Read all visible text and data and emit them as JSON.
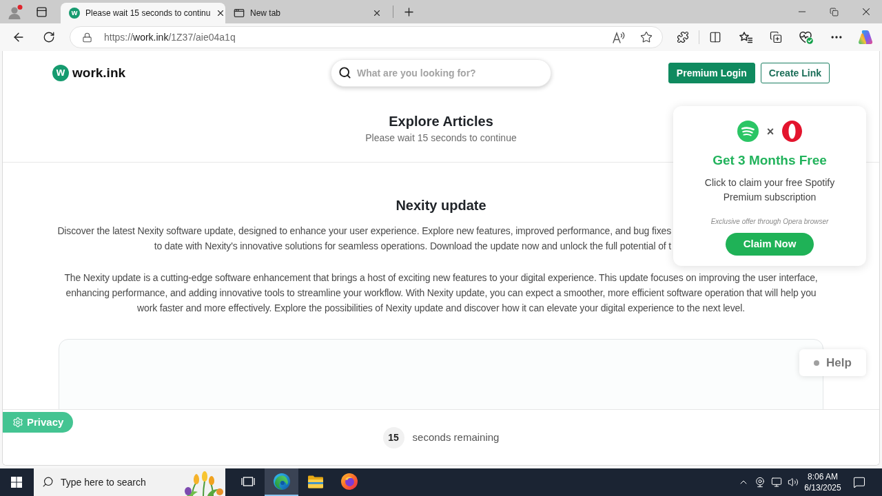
{
  "browser": {
    "tabs": [
      {
        "title": "Please wait 15 seconds to continu",
        "favicon": "w",
        "selected": true
      },
      {
        "title": "New tab",
        "selected": false
      }
    ],
    "address": {
      "scheme": "https://",
      "host": "work.ink",
      "path": "/1Z37/aie04a1q"
    }
  },
  "header": {
    "logo": {
      "mark": "w",
      "name": "work.ink"
    },
    "search": {
      "placeholder": "What are you looking for?"
    },
    "buttons": [
      {
        "label": "Premium Login",
        "kind": "filled"
      },
      {
        "label": "Create Link",
        "kind": "outline"
      }
    ]
  },
  "hero": {
    "title": "Explore Articles",
    "subtitle": "Please wait 15 seconds to continue"
  },
  "article": {
    "title": "Nexity update",
    "paragraphs": [
      {
        "kind": "partly_hidden",
        "lines": [
          "Discover the latest Nexity software update, designed to enhance your user experience. Explore new features, improved performance, and bug fixes",
          "to date with Nexity's innovative solutions for seamless operations. Download the update now and unlock the full potential of t"
        ]
      },
      {
        "kind": "full",
        "lines": [
          "The Nexity update is a cutting-edge software enhancement that brings a host of exciting new features to your digital experience. This update focuses on improving the user interface,",
          "enhancing performance, and adding innovative tools to streamline your workflow. With Nexity update, you can expect a smoother, more efficient software operation that will help you",
          "work faster and more effectively. Explore the possibilities of Nexity update and discover how it can elevate your digital experience to the next level."
        ]
      }
    ]
  },
  "promo": {
    "separator": "×",
    "title": "Get 3 Months Free",
    "text": "Click to claim your free Spotify Premium subscription",
    "note": "Exclusive offer through Opera browser",
    "button": "Claim Now"
  },
  "help": {
    "label": "Help"
  },
  "privacy": {
    "label": "Privacy"
  },
  "countdown": {
    "count": "15",
    "label": "seconds remaining"
  },
  "taskbar": {
    "search": {
      "placeholder": "Type here to search"
    },
    "apps": [
      {
        "kind": "task_view",
        "selected": false
      },
      {
        "kind": "browser",
        "selected": true
      },
      {
        "kind": "files",
        "selected": false
      },
      {
        "kind": "globe_browser",
        "selected": false
      }
    ],
    "time": "8:06 AM",
    "date": "6/13/2025"
  }
}
